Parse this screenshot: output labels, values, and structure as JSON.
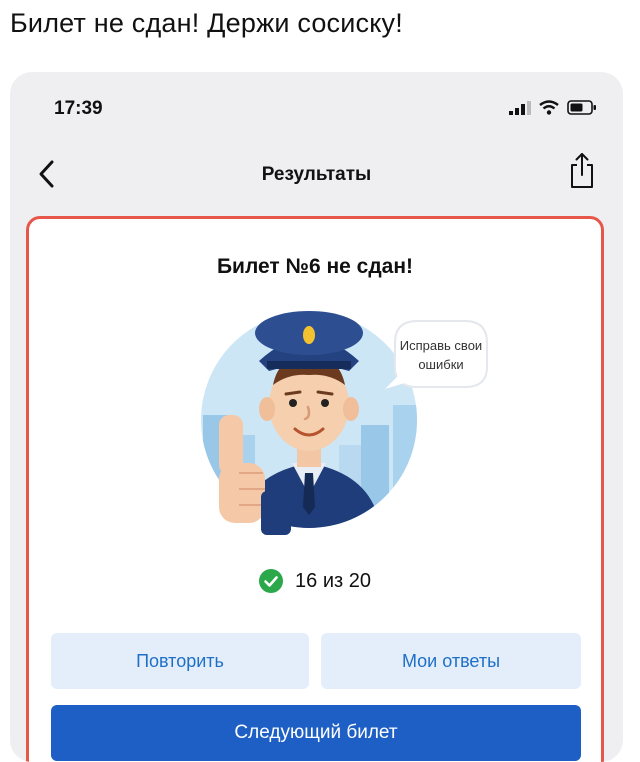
{
  "post": {
    "caption": "Билет не сдан! Держи сосиску!"
  },
  "status_bar": {
    "time": "17:39"
  },
  "nav": {
    "title": "Результаты"
  },
  "result": {
    "title": "Билет №6 не сдан!",
    "speech_line1": "Исправь свои",
    "speech_line2": "ошибки",
    "score": "16 из 20"
  },
  "buttons": {
    "retry": "Повторить",
    "my_answers": "Мои ответы",
    "next_ticket": "Следующий билет"
  },
  "colors": {
    "accent": "#1d5fc4",
    "card_border": "#e6574a",
    "success": "#2aa84a",
    "secondary_bg": "#e4eefb"
  },
  "icons": [
    "signal-icon",
    "wifi-icon",
    "battery-icon",
    "back-chevron-icon",
    "share-icon",
    "check-circle-icon"
  ]
}
